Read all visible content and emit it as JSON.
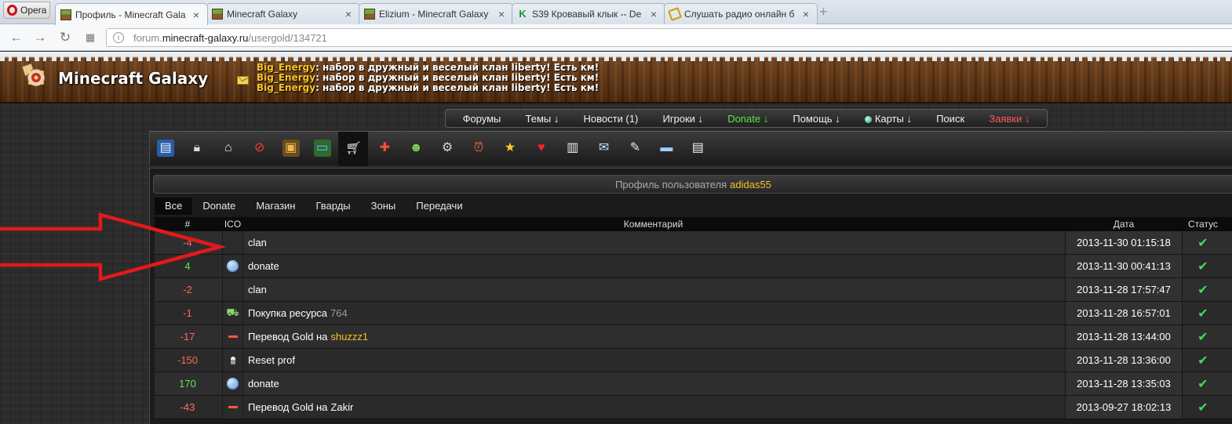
{
  "browser": {
    "opera_label": "Opera",
    "tabs": [
      {
        "label": "Профиль - Minecraft Gala",
        "active": true,
        "icon": "grass-block-icon"
      },
      {
        "label": "Minecraft Galaxy",
        "active": false,
        "icon": "grass-block-icon"
      },
      {
        "label": "Elizium - Minecraft Galaxy",
        "active": false,
        "icon": "grass-block-icon"
      },
      {
        "label": "S39 Кровавый клык -- De",
        "active": false,
        "icon": "k-icon"
      },
      {
        "label": "Слушать радио онлайн б",
        "active": false,
        "icon": "radio-icon"
      }
    ],
    "url": {
      "prefix": "forum.",
      "host": "minecraft-galaxy.ru",
      "path": "/usergold/134721"
    }
  },
  "site": {
    "logo": "Minecraft Galaxy",
    "shouts": [
      {
        "user": "Big_Energy",
        "msg": ": набор в дружный и веселый клан liberty! Есть км!"
      },
      {
        "user": "Big_Energy",
        "msg": ": набор в дружный и веселый клан liberty! Есть км!"
      },
      {
        "user": "Big_Energy",
        "msg": ": набор в дружный и веселый клан liberty! Есть км!"
      }
    ],
    "nav": [
      {
        "label": "Форумы",
        "color": "white"
      },
      {
        "label": "Темы ↓",
        "color": "white"
      },
      {
        "label": "Новости (1)",
        "color": "white"
      },
      {
        "label": "Игроки ↓",
        "color": "white"
      },
      {
        "label": "Donate ↓",
        "color": "green"
      },
      {
        "label": "Помощь ↓",
        "color": "white"
      },
      {
        "label": "Карты ↓",
        "color": "white"
      },
      {
        "label": "Поиск",
        "color": "white"
      },
      {
        "label": "Заявки ↓",
        "color": "red"
      }
    ],
    "toolbar_icons": [
      "profile-card-icon",
      "lock-icon",
      "home-icon",
      "ban-icon",
      "picture-frame-icon",
      "landscape-icon",
      "cart-icon",
      "medal-icon",
      "user-icon",
      "gear-icon",
      "alarm-clock-icon",
      "star-icon",
      "heart-icon",
      "bar-chart-icon",
      "envelope-icon",
      "edit-icon",
      "folder-icon",
      "notepad-icon"
    ],
    "profile": {
      "prefix": "Профиль пользователя",
      "username": "adidas55"
    },
    "subtabs": [
      "Все",
      "Donate",
      "Магазин",
      "Гварды",
      "Зоны",
      "Передачи"
    ],
    "table": {
      "headers": {
        "num": "#",
        "ico": "ICO",
        "comment": "Комментарий",
        "date": "Дата",
        "status": "Статус"
      },
      "rows": [
        {
          "amount": "-4",
          "sign": "neg",
          "icon": "none",
          "comment": "clan",
          "qty": "",
          "target": "",
          "target_style": "",
          "date": "2013-11-30 01:15:18",
          "status": "✔"
        },
        {
          "amount": "4",
          "sign": "pos",
          "icon": "donate",
          "comment": "donate",
          "qty": "",
          "target": "",
          "target_style": "",
          "date": "2013-11-30 00:41:13",
          "status": "✔"
        },
        {
          "amount": "-2",
          "sign": "neg",
          "icon": "none",
          "comment": "clan",
          "qty": "",
          "target": "",
          "target_style": "",
          "date": "2013-11-28 17:57:47",
          "status": "✔"
        },
        {
          "amount": "-1",
          "sign": "neg",
          "icon": "buy",
          "comment": "Покупка ресурса",
          "qty": "764",
          "target": "",
          "target_style": "",
          "date": "2013-11-28 16:57:01",
          "status": "✔"
        },
        {
          "amount": "-17",
          "sign": "neg",
          "icon": "transfer",
          "comment": "Перевод Gold на",
          "qty": "",
          "target": "shuzzz1",
          "target_style": "gold",
          "date": "2013-11-28 13:44:00",
          "status": "✔"
        },
        {
          "amount": "-150",
          "sign": "neg",
          "icon": "prof",
          "comment": "Reset prof",
          "qty": "",
          "target": "",
          "target_style": "",
          "date": "2013-11-28 13:36:00",
          "status": "✔"
        },
        {
          "amount": "170",
          "sign": "pos",
          "icon": "donate",
          "comment": "donate",
          "qty": "",
          "target": "",
          "target_style": "",
          "date": "2013-11-28 13:35:03",
          "status": "✔"
        },
        {
          "amount": "-43",
          "sign": "neg",
          "icon": "transfer",
          "comment": "Перевод Gold на",
          "qty": "",
          "target": "Zakir",
          "target_style": "plain",
          "date": "2013-09-27 18:02:13",
          "status": "✔"
        }
      ]
    }
  },
  "annotation": {
    "arrow_color": "#e3191c"
  }
}
